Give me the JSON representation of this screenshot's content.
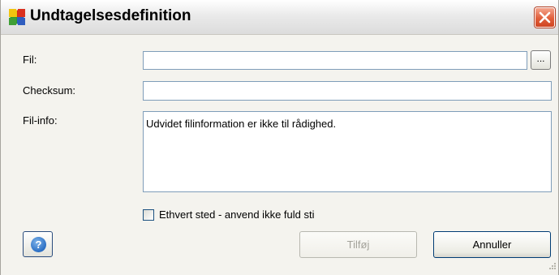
{
  "window": {
    "title": "Undtagelsesdefinition",
    "accent_colors": {
      "close_button": "#e15f3b",
      "input_border": "#7f9db9",
      "help_icon": "#2b6fc4"
    }
  },
  "form": {
    "file_label": "Fil:",
    "file_value": "",
    "browse_label": "...",
    "checksum_label": "Checksum:",
    "checksum_value": "",
    "fileinfo_label": "Fil-info:",
    "fileinfo_value": "Udvidet filinformation er ikke til rådighed."
  },
  "options": {
    "anywhere_label": "Ethvert sted - anvend ikke fuld sti",
    "anywhere_checked": false
  },
  "buttons": {
    "add_label": "Tilføj",
    "cancel_label": "Annuller",
    "help_icon": "question-icon"
  }
}
